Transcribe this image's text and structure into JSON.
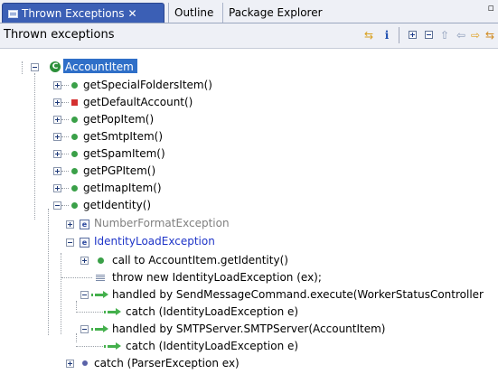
{
  "tabs": [
    {
      "label": "Thrown Exceptions",
      "close": "✕",
      "active": true
    },
    {
      "label": "Outline",
      "active": false
    },
    {
      "label": "Package Explorer",
      "active": false
    }
  ],
  "window_controls": "▫",
  "view_title": "Thrown exceptions",
  "toolbar": {
    "link_icon": "⇆",
    "info_icon": "i",
    "expand_icon": "⊞",
    "collapse_icon": "⊟",
    "up_icon": "⇧",
    "back_icon": "⇦",
    "forward_icon": "⇨",
    "sync_icon": "⇆"
  },
  "colors": {
    "accent": "#3b5fb5",
    "selection": "#2f6fc8",
    "class_icon": "#2c8f3a",
    "public_method": "#3aa048",
    "private_method": "#d43030",
    "handler_arrow": "#44b04c",
    "exception_text": "#1f35c8",
    "muted_text": "#808080"
  },
  "tree": {
    "root": {
      "label": "AccountItem",
      "icon": "class-icon"
    },
    "methods": [
      {
        "label": "getSpecialFoldersItem()",
        "icon": "public-method-icon"
      },
      {
        "label": "getDefaultAccount()",
        "icon": "private-method-icon"
      },
      {
        "label": "getPopItem()",
        "icon": "public-method-icon"
      },
      {
        "label": "getSmtpItem()",
        "icon": "public-method-icon"
      },
      {
        "label": "getSpamItem()",
        "icon": "public-method-icon"
      },
      {
        "label": "getPGPItem()",
        "icon": "public-method-icon"
      },
      {
        "label": "getImapItem()",
        "icon": "public-method-icon"
      },
      {
        "label": "getIdentity()",
        "icon": "public-method-icon"
      }
    ],
    "exceptions": [
      {
        "label": "NumberFormatException",
        "icon": "exception-icon",
        "letter": "e"
      },
      {
        "label": "IdentityLoadException",
        "icon": "exception-icon",
        "letter": "e"
      }
    ],
    "identity_children": [
      {
        "label": "call to AccountItem.getIdentity()",
        "icon": "public-method-icon"
      },
      {
        "label": "throw new IdentityLoadException (ex);",
        "icon": "throw-icon"
      },
      {
        "label": "handled by SendMessageCommand.execute(WorkerStatusController",
        "icon": "handler-arrow-icon"
      },
      {
        "label": "catch (IdentityLoadException e)",
        "icon": "handler-arrow-icon"
      },
      {
        "label": "handled by SMTPServer.SMTPServer(AccountItem)",
        "icon": "handler-arrow-icon"
      },
      {
        "label": "catch (IdentityLoadException e)",
        "icon": "handler-arrow-icon"
      }
    ],
    "last": {
      "label": "catch (ParserException ex)",
      "icon": "bullet-icon"
    }
  }
}
